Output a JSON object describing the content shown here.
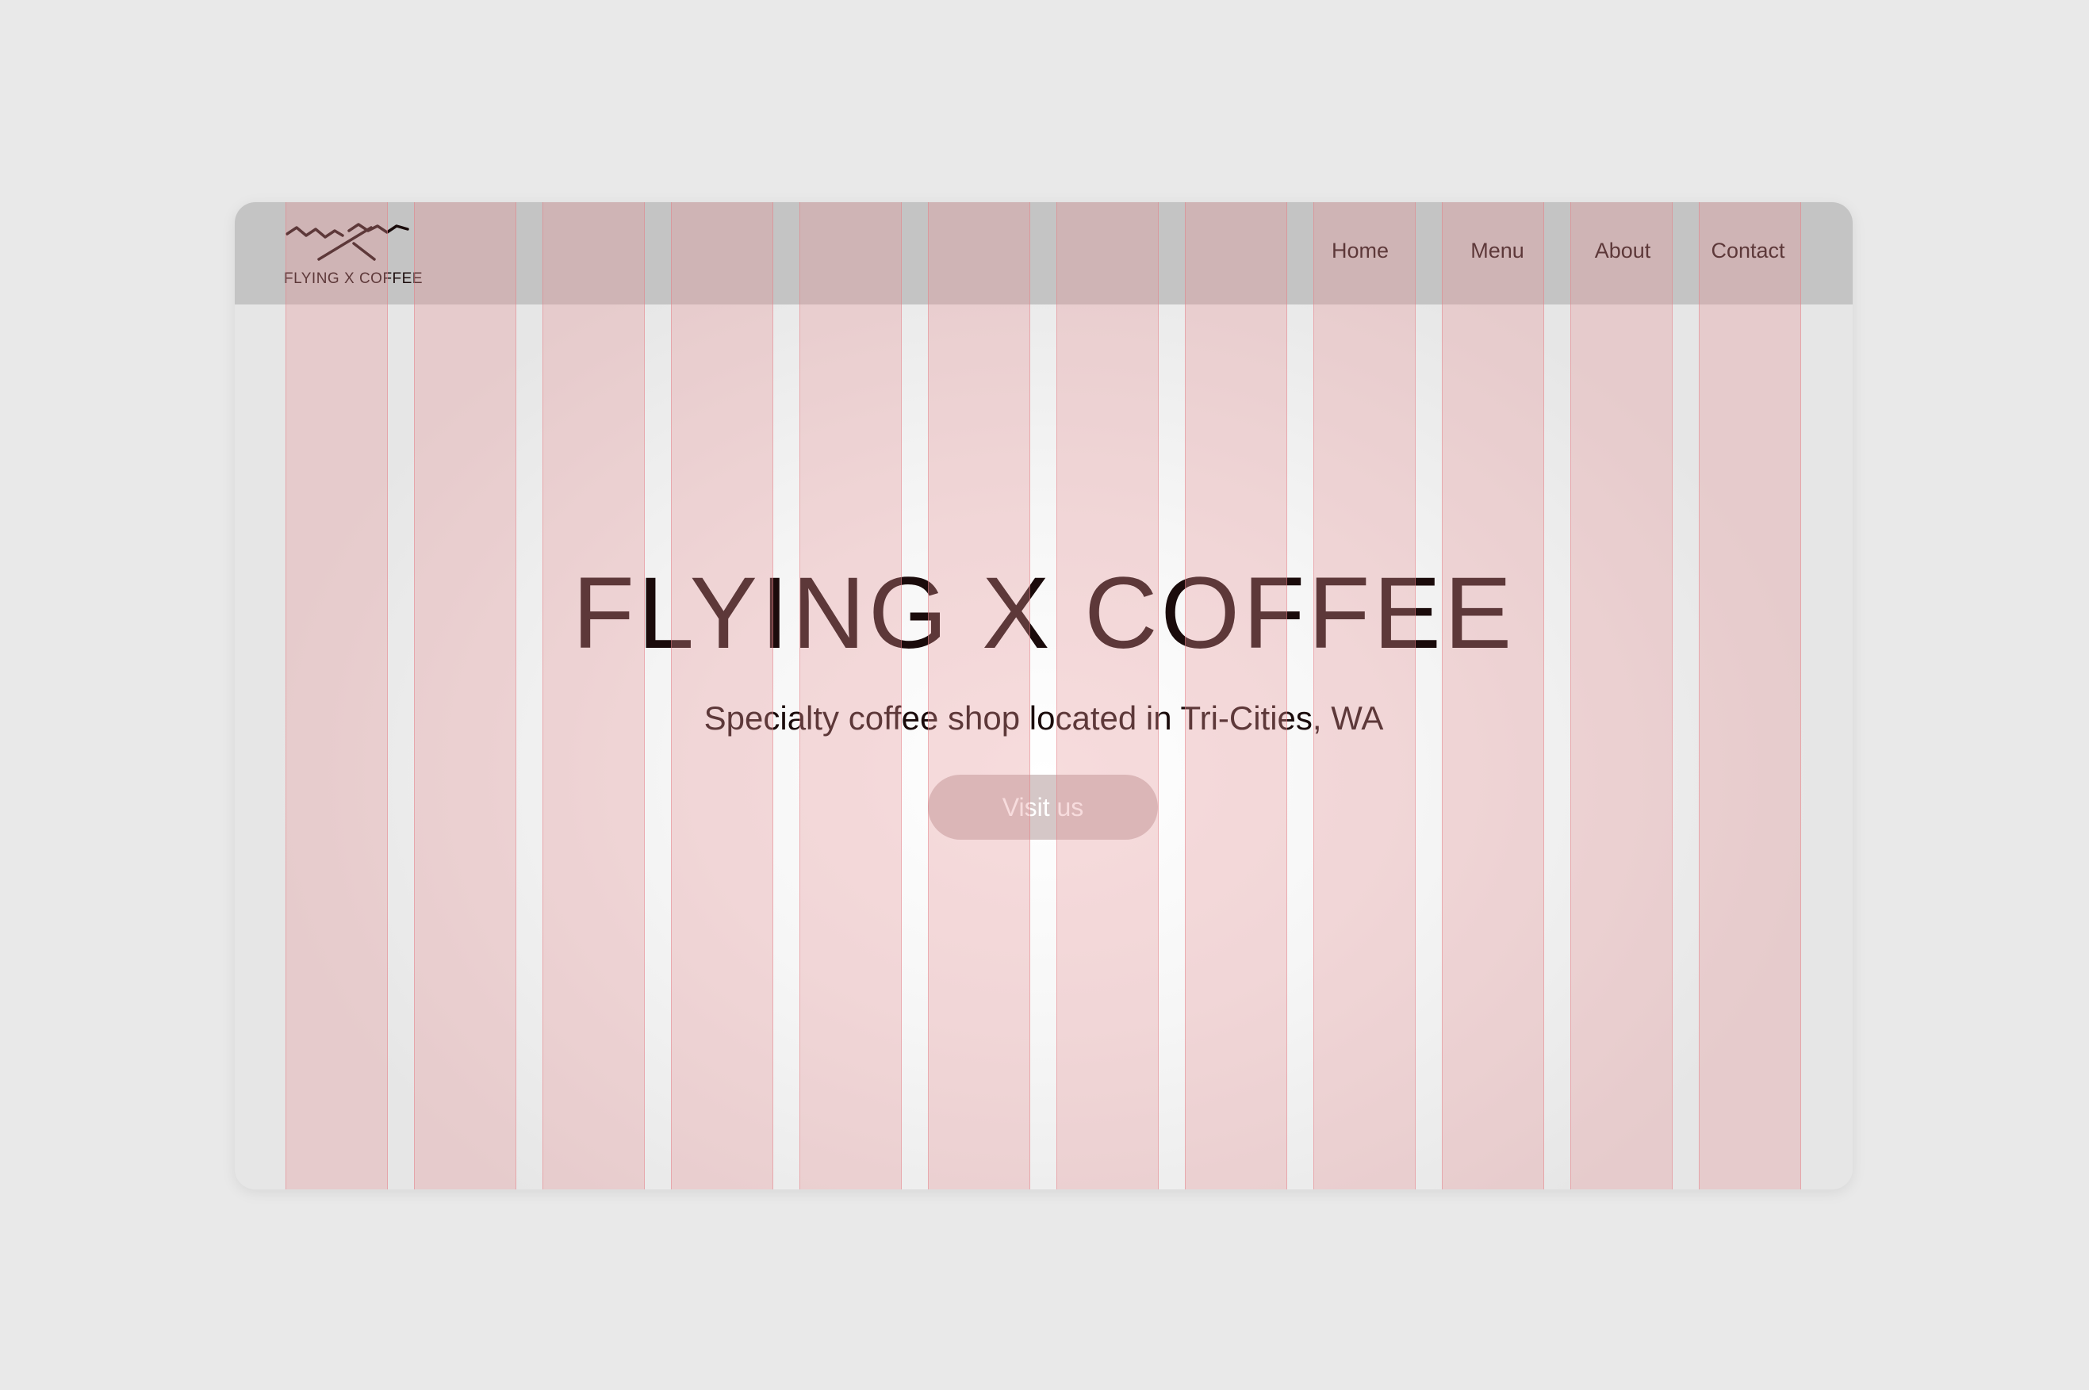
{
  "brand": {
    "logo_text": "FLYING X COFFEE",
    "logo_icon": "flying-x-mountain-logo"
  },
  "nav": {
    "items": [
      {
        "label": "Home"
      },
      {
        "label": "Menu"
      },
      {
        "label": "About"
      },
      {
        "label": "Contact"
      }
    ]
  },
  "hero": {
    "title": "FLYING X COFFEE",
    "subtitle": "Specialty coffee shop located in Tri-Cities, WA",
    "cta_label": "Visit us"
  },
  "layout_grid": {
    "columns": 12,
    "overlay_color": "#e79499"
  },
  "colors": {
    "page_background": "#e9e9e9",
    "navbar_background": "#c4c4c4",
    "text": "#1a0b0b",
    "button_background": "#d5c7c7",
    "button_text": "#ffffff"
  }
}
